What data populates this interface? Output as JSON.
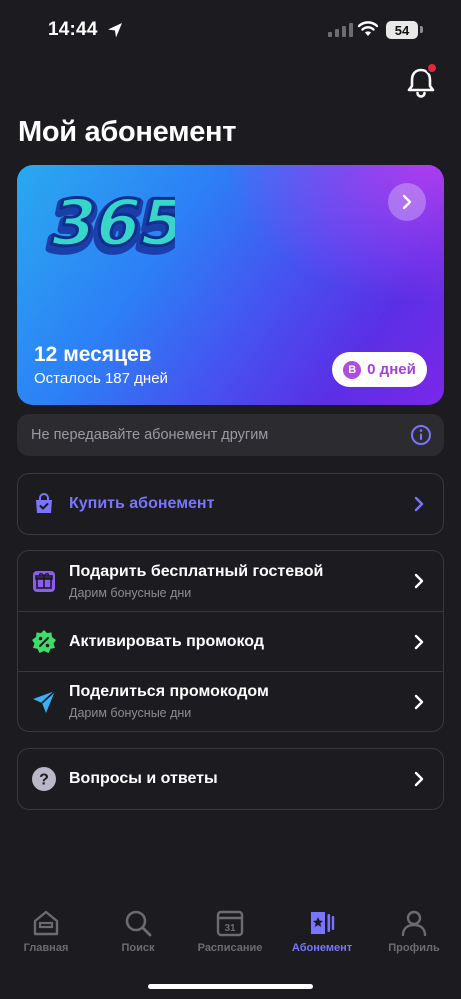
{
  "status_bar": {
    "time": "14:44",
    "battery": "54"
  },
  "page": {
    "title": "Мой абонемент"
  },
  "card": {
    "logo_text": "365",
    "plan": "12 месяцев",
    "remaining": "Осталось 187 дней",
    "coin_letter": "В",
    "days": "0 дней",
    "colors": {
      "gradient_start": "#2aa9f0",
      "gradient_end": "#7b27e8"
    }
  },
  "notice": {
    "text": "Не передавайте абонемент другим"
  },
  "buy": {
    "label": "Купить абонемент",
    "color": "#7a74ff"
  },
  "menu": [
    {
      "label": "Подарить бесплатный гостевой",
      "sub": "Дарим бонусные дни",
      "icon": "gift-icon"
    },
    {
      "label": "Активировать промокод",
      "sub": "",
      "icon": "percent-badge-icon"
    },
    {
      "label": "Поделиться промокодом",
      "sub": "Дарим бонусные дни",
      "icon": "send-icon"
    }
  ],
  "faq": {
    "label": "Вопросы и ответы",
    "icon": "question-icon"
  },
  "tabs": [
    {
      "label": "Главная",
      "icon": "home-icon"
    },
    {
      "label": "Поиск",
      "icon": "search-icon"
    },
    {
      "label": "Расписание",
      "icon": "calendar-icon",
      "calendar_day": "31"
    },
    {
      "label": "Абонемент",
      "icon": "membership-icon",
      "active": true
    },
    {
      "label": "Профиль",
      "icon": "profile-icon"
    }
  ]
}
